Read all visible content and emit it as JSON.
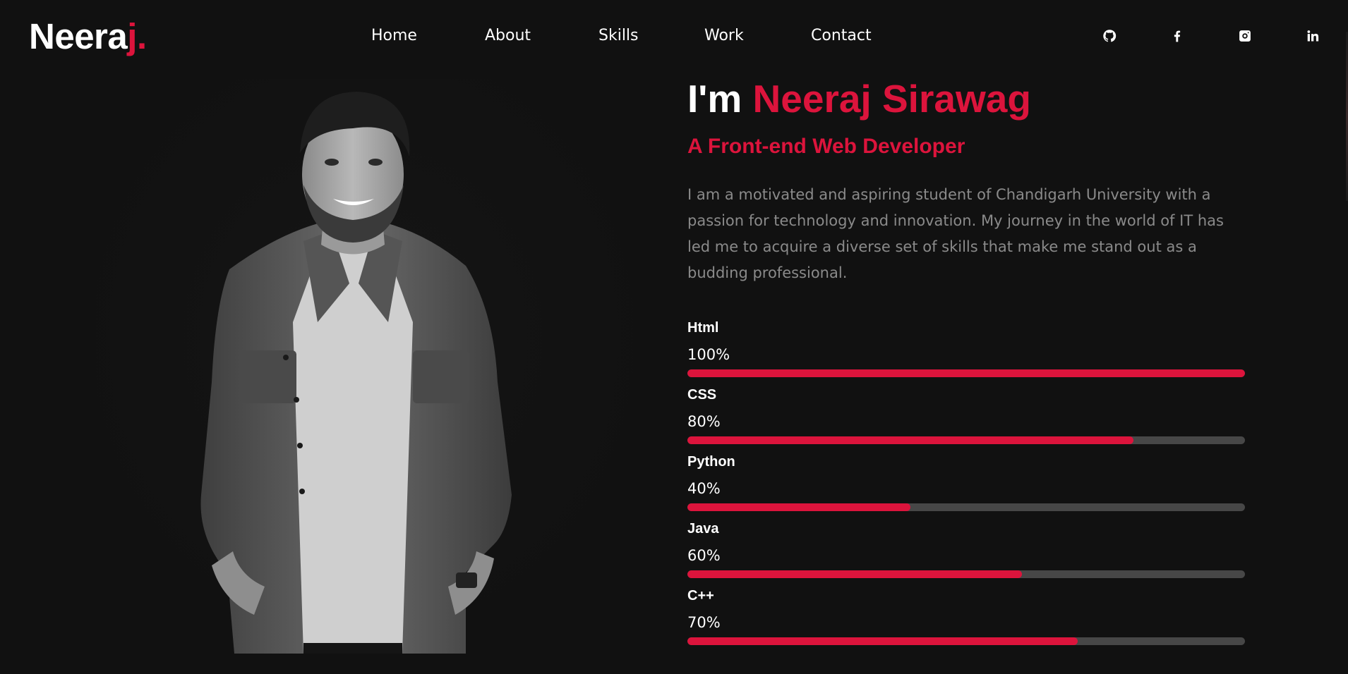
{
  "header": {
    "logo_text": "Neera",
    "logo_accent": "j.",
    "nav": [
      {
        "label": "Home"
      },
      {
        "label": "About"
      },
      {
        "label": "Skills"
      },
      {
        "label": "Work"
      },
      {
        "label": "Contact"
      }
    ],
    "social": [
      {
        "icon": "github-icon"
      },
      {
        "icon": "facebook-icon"
      },
      {
        "icon": "instagram-icon"
      },
      {
        "icon": "linkedin-icon"
      }
    ]
  },
  "intro": {
    "prefix": "I'm ",
    "name": "Neeraj Sirawag",
    "subtitle": "A Front-end Web Developer",
    "bio": "I am a motivated and aspiring student of Chandigarh University with a passion for technology and innovation. My journey in the world of IT has led me to acquire a diverse set of skills that make me stand out as a budding professional."
  },
  "skills": [
    {
      "name": "Html",
      "percent_label": "100%",
      "value": 100
    },
    {
      "name": "CSS",
      "percent_label": "80%",
      "value": 80
    },
    {
      "name": "Python",
      "percent_label": "40%",
      "value": 40
    },
    {
      "name": "Java",
      "percent_label": "60%",
      "value": 60
    },
    {
      "name": "C++",
      "percent_label": "70%",
      "value": 70
    }
  ],
  "colors": {
    "accent": "#dc143c",
    "background": "#111111",
    "bar_track": "#474747",
    "muted_text": "#8a8a8a"
  }
}
